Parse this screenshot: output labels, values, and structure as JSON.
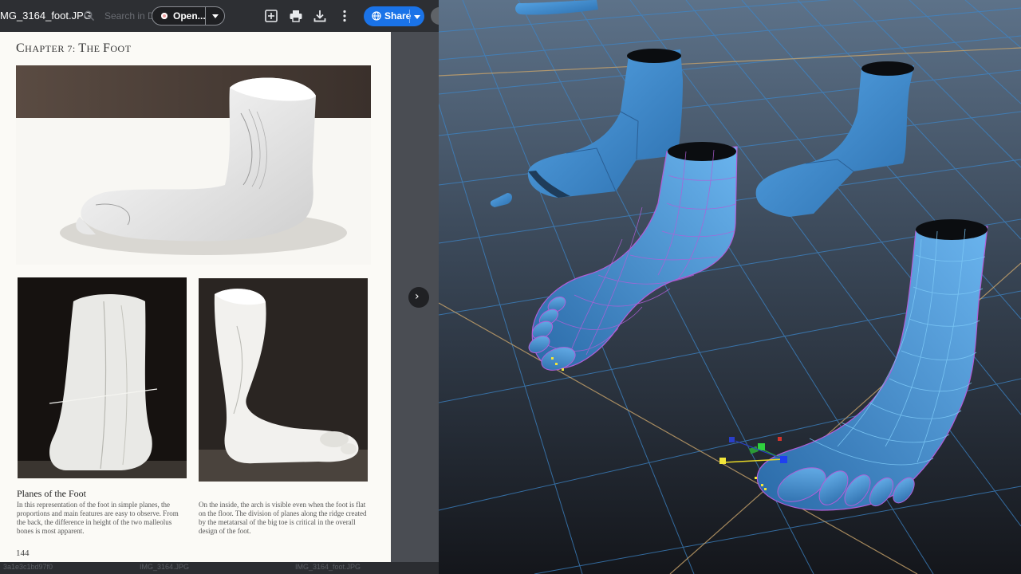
{
  "viewer": {
    "file_name": "MG_3164_foot.JPG",
    "search_placeholder": "Search in D",
    "open_label": "Open...",
    "share_label": "Share",
    "page": {
      "chapter_prefix": "C",
      "chapter_rest": "HAPTER 7: ",
      "chapter_t": "T",
      "chapter_he": "HE ",
      "chapter_f": "F",
      "chapter_oot": "OOT",
      "section_title": "Planes of the Foot",
      "left_paragraph": "In this representation of the foot in simple planes, the proportions and main features are easy to observe. From the back, the difference in height of the two malleolus bones is most apparent.",
      "right_paragraph": "On the inside, the arch is visible even when the foot is flat on the floor. The division of planes along the ridge created by the metatarsal of the big toe is critical in the overall design of the foot.",
      "page_number": "144"
    },
    "bottom_strip": [
      "3a1e3c1bd97f0",
      "IMG_3164.JPG",
      "IMG_3164_foot.JPG"
    ]
  },
  "icons": {
    "search": "search-icon",
    "add": "add-to-drive-icon",
    "print": "print-icon",
    "download": "download-icon",
    "more": "more-vert-icon",
    "share": "globe-icon",
    "next": "chevron-right-icon"
  },
  "colors": {
    "topbar": "#2d2f33",
    "share_blue": "#1a73e8",
    "viewport_bg_top": "#5a6e84",
    "viewport_bg_bottom": "#16181d",
    "model_blue": "#3f8fd4",
    "wire_purple": "#b15fd8"
  }
}
